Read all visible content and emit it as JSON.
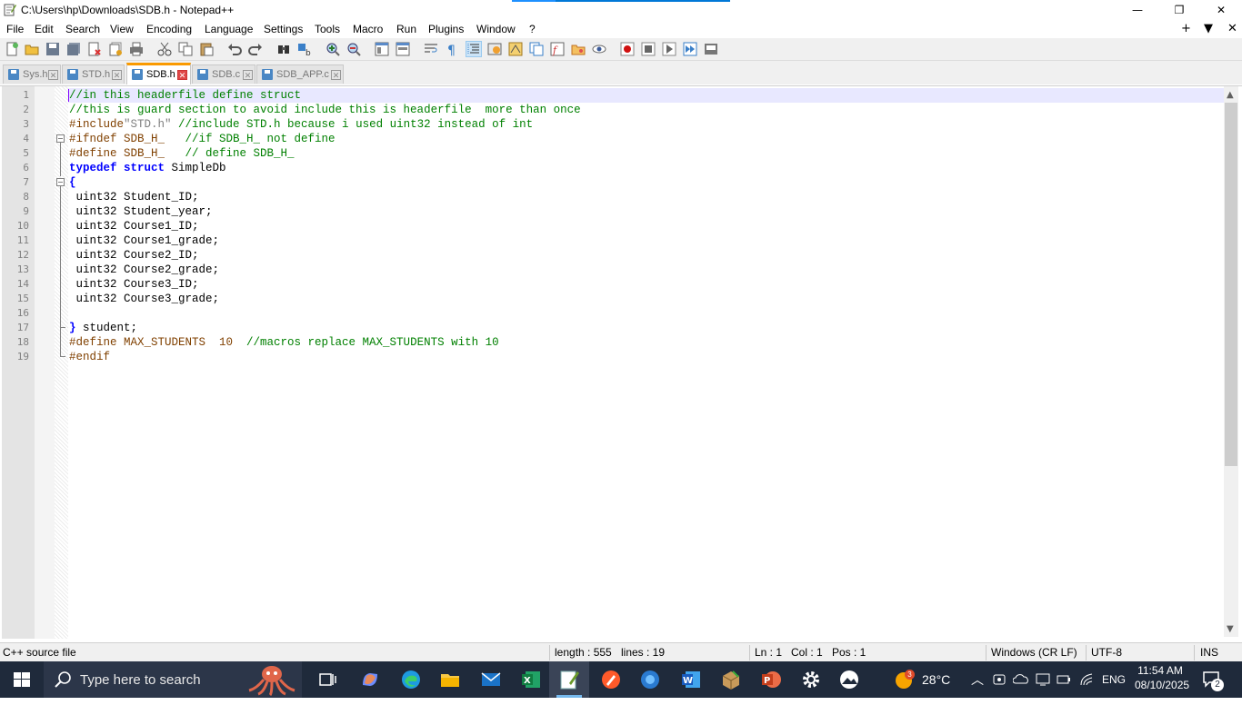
{
  "window": {
    "title": "C:\\Users\\hp\\Downloads\\SDB.h - Notepad++",
    "minimize": "—",
    "maximize": "❐",
    "close": "✕"
  },
  "menu": {
    "items": [
      "File",
      "Edit",
      "Search",
      "View",
      "Encoding",
      "Language",
      "Settings",
      "Tools",
      "Macro",
      "Run",
      "Plugins",
      "Window",
      "?"
    ],
    "right": [
      "+",
      "▼",
      "✕"
    ]
  },
  "tabs": [
    {
      "label": "Sys.h",
      "active": false
    },
    {
      "label": "STD.h",
      "active": false
    },
    {
      "label": "SDB.h",
      "active": true
    },
    {
      "label": "SDB.c",
      "active": false
    },
    {
      "label": "SDB_APP.c",
      "active": false
    }
  ],
  "editor": {
    "line_numbers": [
      "1",
      "2",
      "3",
      "4",
      "5",
      "6",
      "7",
      "8",
      "9",
      "10",
      "11",
      "12",
      "13",
      "14",
      "15",
      "16",
      "17",
      "18",
      "19"
    ],
    "lines": [
      [
        {
          "c": "cm",
          "t": "//in this headerfile define struct"
        }
      ],
      [
        {
          "c": "cm",
          "t": "//this is guard section to avoid include this is headerfile  more than once"
        }
      ],
      [
        {
          "c": "pp",
          "t": "#include"
        },
        {
          "c": "st",
          "t": "\"STD.h\""
        },
        {
          "c": "cm",
          "t": " //include STD.h because i used uint32 instead of int"
        }
      ],
      [
        {
          "c": "pp",
          "t": "#ifndef SDB_H_"
        },
        {
          "c": "cm",
          "t": "   //if SDB_H_ not define"
        }
      ],
      [
        {
          "c": "pp",
          "t": "#define SDB_H_"
        },
        {
          "c": "cm",
          "t": "   // define SDB_H_"
        }
      ],
      [
        {
          "c": "kw",
          "t": "typedef"
        },
        {
          "c": "",
          "t": " "
        },
        {
          "c": "kw",
          "t": "struct"
        },
        {
          "c": "",
          "t": " SimpleDb"
        }
      ],
      [
        {
          "c": "kw",
          "t": "{"
        }
      ],
      [
        {
          "c": "",
          "t": " uint32 Student_ID;"
        }
      ],
      [
        {
          "c": "",
          "t": " uint32 Student_year;"
        }
      ],
      [
        {
          "c": "",
          "t": " uint32 Course1_ID;"
        }
      ],
      [
        {
          "c": "",
          "t": " uint32 Course1_grade;"
        }
      ],
      [
        {
          "c": "",
          "t": " uint32 Course2_ID;"
        }
      ],
      [
        {
          "c": "",
          "t": " uint32 Course2_grade;"
        }
      ],
      [
        {
          "c": "",
          "t": " uint32 Course3_ID;"
        }
      ],
      [
        {
          "c": "",
          "t": " uint32 Course3_grade;"
        }
      ],
      [
        {
          "c": "",
          "t": ""
        }
      ],
      [
        {
          "c": "kw",
          "t": "}"
        },
        {
          "c": "",
          "t": " student;"
        }
      ],
      [
        {
          "c": "pp",
          "t": "#define MAX_STUDENTS  10"
        },
        {
          "c": "cm",
          "t": "  //macros replace MAX_STUDENTS with 10"
        }
      ],
      [
        {
          "c": "pp",
          "t": "#endif"
        }
      ]
    ]
  },
  "status": {
    "filetype": "C++ source file",
    "length": "length : 555",
    "lines": "lines : 19",
    "ln": "Ln : 1",
    "col": "Col : 1",
    "pos": "Pos : 1",
    "eol": "Windows (CR LF)",
    "encoding": "UTF-8",
    "mode": "INS"
  },
  "taskbar": {
    "search_placeholder": "Type here to search",
    "temperature": "28°C",
    "weather_badge": "3",
    "language": "ENG",
    "time": "11:54 AM",
    "date": "08/10/2025",
    "notification_count": "2"
  },
  "colors": {
    "comment": "#008000",
    "keyword": "#0000ff",
    "preprocessor": "#804000",
    "string": "#808080",
    "active_tab_accent": "#fa9a00",
    "taskbar": "#1f2a3b"
  }
}
